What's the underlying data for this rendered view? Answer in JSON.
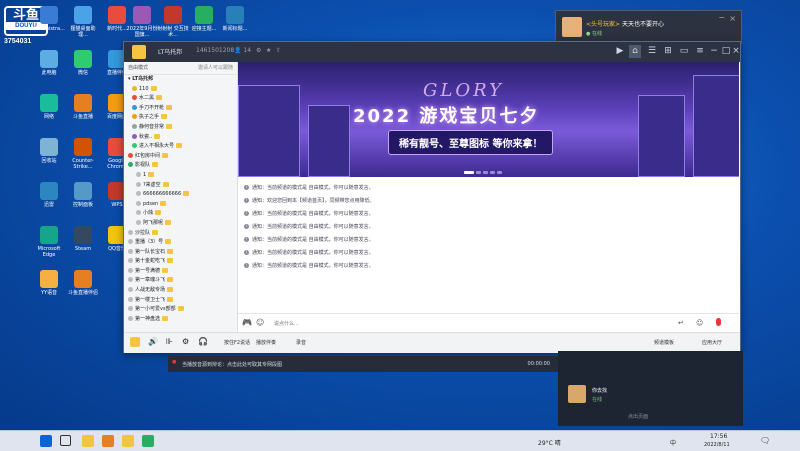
{
  "watermark": {
    "logo": "斗鱼",
    "logo_sub": "DOUYU",
    "room_id": "3754031"
  },
  "desktop_icons": [
    {
      "label": "Administra...",
      "color": "#3a7bd5"
    },
    {
      "label": "狸猫桌面助理...",
      "color": "#4aa3e8"
    },
    {
      "label": "新时代...",
      "color": "#e74c3c"
    },
    {
      "label": "2022年9月份国旗...",
      "color": "#9b59b6"
    },
    {
      "label": "射射射 交互技术...",
      "color": "#c0392b"
    },
    {
      "label": "迎接主题...",
      "color": "#27ae60"
    },
    {
      "label": "新闻标题...",
      "color": "#2980b9"
    },
    {
      "label": "此电脑",
      "color": "#5dade2"
    },
    {
      "label": "微信",
      "color": "#2ecc71"
    },
    {
      "label": "直播伴侣",
      "color": "#3498db"
    },
    {
      "label": "网络",
      "color": "#1abc9c"
    },
    {
      "label": "斗鱼直播",
      "color": "#e67e22"
    },
    {
      "label": "百度网盘",
      "color": "#f39c12"
    },
    {
      "label": "回收站",
      "color": "#7fb3d5"
    },
    {
      "label": "Counter-Strike...",
      "color": "#d35400"
    },
    {
      "label": "Google Chrome",
      "color": "#e74c3c"
    },
    {
      "label": "迅雷",
      "color": "#2e86c1"
    },
    {
      "label": "控制面板",
      "color": "#5499c7"
    },
    {
      "label": "WPS",
      "color": "#c0392b"
    },
    {
      "label": "Microsoft Edge",
      "color": "#17a589"
    },
    {
      "label": "Steam",
      "color": "#34495e"
    },
    {
      "label": "QQ音乐",
      "color": "#f1c40f"
    },
    {
      "label": "YY语音",
      "color": "#f5b041"
    },
    {
      "label": "斗鱼直播伴侣",
      "color": "#e67e22"
    }
  ],
  "window": {
    "title": "LT乌托邦",
    "room_number": "1461501208",
    "member_count": "14",
    "top_icons": [
      "video-icon",
      "home-icon",
      "list-icon",
      "gamepad-icon",
      "screen-icon",
      "menu-icon",
      "minimize-icon",
      "maximize-icon",
      "close-icon"
    ]
  },
  "sidebar": {
    "mode": "自由模式",
    "invite": "邀请人可以跟随",
    "channel_name": "LT乌托邦",
    "rows": [
      {
        "text": "110",
        "indent": 8,
        "dot": "#f0b429"
      },
      {
        "text": "水二黑",
        "indent": 8,
        "dot": "#e74c3c"
      },
      {
        "text": "手刀不开枪",
        "indent": 8,
        "dot": "#3498db"
      },
      {
        "text": "执子之手",
        "indent": 8,
        "dot": "#f39c12"
      },
      {
        "text": "静何音芬常",
        "indent": 8,
        "dot": "#95a5a6"
      },
      {
        "text": "秋瓷..",
        "indent": 8,
        "dot": "#9b59b6"
      },
      {
        "text": "进入不相永大号",
        "indent": 8,
        "dot": "#2ecc71"
      },
      {
        "text": "红包房中间",
        "indent": 4,
        "dot": "#e74c3c"
      },
      {
        "text": "影视队",
        "indent": 4,
        "dot": "#27ae60"
      },
      {
        "text": "1",
        "indent": 12,
        "dot": "#bbb"
      },
      {
        "text": "?来虚空",
        "indent": 12,
        "dot": "#bbb"
      },
      {
        "text": "666666666666",
        "indent": 12,
        "dot": "#bbb"
      },
      {
        "text": "pdsen",
        "indent": 12,
        "dot": "#bbb"
      },
      {
        "text": "小烛",
        "indent": 12,
        "dot": "#bbb"
      },
      {
        "text": "阿飞那呢",
        "indent": 12,
        "dot": "#bbb"
      },
      {
        "text": "沙拉队",
        "indent": 4,
        "dot": "#bbb"
      },
      {
        "text": "重播（3）号",
        "indent": 4,
        "dot": "#bbb"
      },
      {
        "text": "第一队长宝石",
        "indent": 4,
        "dot": "#bbb"
      },
      {
        "text": "第十金蛇吃飞",
        "indent": 4,
        "dot": "#bbb"
      },
      {
        "text": "第一号满德",
        "indent": 4,
        "dot": "#bbb"
      },
      {
        "text": "第一章魂斗飞",
        "indent": 4,
        "dot": "#bbb"
      },
      {
        "text": "人战无敌专场",
        "indent": 4,
        "dot": "#bbb"
      },
      {
        "text": "第一楼卫士飞",
        "indent": 4,
        "dot": "#bbb"
      },
      {
        "text": "第一小可爱vs部部",
        "indent": 4,
        "dot": "#bbb"
      },
      {
        "text": "第一神盘选",
        "indent": 4,
        "dot": "#bbb"
      }
    ]
  },
  "banner": {
    "glory": "GLORY",
    "title": "2022 游戏宝贝七夕",
    "subtitle": "稀有靓号、至尊图标 等你来拿！"
  },
  "chat": {
    "notices": [
      "通知：当前频道的模式是 自由模式，你可以随意发言。",
      "通知：欢迎您回到本【频道首页】，同频带您点用降低。",
      "通知：当前频道的模式是 自由模式，你可以随意发言。",
      "通知：当前频道的模式是 自由模式，你可以随意发言。",
      "通知：当前频道的模式是 自由模式，你可以随意发言。",
      "通知：当前频道的模式是 自由模式，你可以随意发言。",
      "通知：当前频道的模式是 自由模式，你可以随意发言。"
    ],
    "input_placeholder": "说点什么..."
  },
  "bottombar": {
    "items": [
      "按住F2说话",
      "播放伴奏",
      "录音"
    ],
    "right_items": [
      "频道模板",
      "应用大厅"
    ]
  },
  "notification": {
    "sender": "<头号玩家>",
    "message": "天天也不要开心",
    "sub": "● 在线"
  },
  "broadcast": {
    "text": "当播放音源到辩论：点击此处可取其专网段图",
    "right_text": "00:00:00"
  },
  "rpanel": {
    "name": "你去找",
    "status": "在线",
    "footer": "点出页面"
  },
  "taskbar": {
    "weather": "29°C 晴",
    "ime": "中",
    "time": "17:56",
    "date": "2022/8/11"
  }
}
